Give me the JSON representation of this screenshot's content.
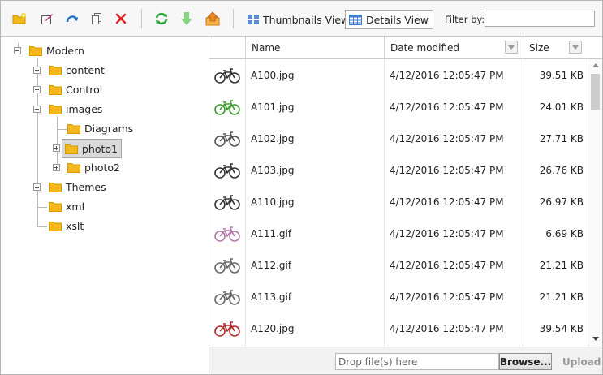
{
  "toolbar": {
    "buttons": [
      {
        "icon": "new-folder-icon",
        "color": "#e8a400"
      },
      {
        "icon": "rename-icon",
        "color": "#c12a7c"
      },
      {
        "icon": "redo-icon",
        "color": "#1f6fc4"
      },
      {
        "icon": "copy-icon",
        "color": "#555555"
      },
      {
        "icon": "delete-icon",
        "color": "#e02020"
      },
      {
        "icon": "refresh-icon",
        "color": "#2aa43a"
      },
      {
        "icon": "download-icon",
        "color": "#7fd07a"
      },
      {
        "icon": "upload-folder-icon",
        "color": "#e98a2a"
      }
    ],
    "thumbnails_view_label": "Thumbnails View",
    "details_view_label": "Details View",
    "filter_label": "Filter by:",
    "filter_value": ""
  },
  "tree": {
    "root": "Modern",
    "nodes": [
      "content",
      "Control",
      "images",
      "Diagrams",
      "photo1",
      "photo2",
      "Themes",
      "xml",
      "xslt"
    ],
    "selected": "photo1"
  },
  "grid": {
    "columns": [
      "Name",
      "Date modified",
      "Size"
    ],
    "rows": [
      {
        "name": "A100.jpg",
        "date": "4/12/2016 12:05:47 PM",
        "size": "39.51 KB",
        "bike_color": "#333333"
      },
      {
        "name": "A101.jpg",
        "date": "4/12/2016 12:05:47 PM",
        "size": "24.01 KB",
        "bike_color": "#3a9a2a"
      },
      {
        "name": "A102.jpg",
        "date": "4/12/2016 12:05:47 PM",
        "size": "27.71 KB",
        "bike_color": "#555555"
      },
      {
        "name": "A103.jpg",
        "date": "4/12/2016 12:05:47 PM",
        "size": "26.76 KB",
        "bike_color": "#333333"
      },
      {
        "name": "A110.jpg",
        "date": "4/12/2016 12:05:47 PM",
        "size": "26.97 KB",
        "bike_color": "#333333"
      },
      {
        "name": "A111.gif",
        "date": "4/12/2016 12:05:47 PM",
        "size": "6.69 KB",
        "bike_color": "#b07aa8"
      },
      {
        "name": "A112.gif",
        "date": "4/12/2016 12:05:47 PM",
        "size": "21.21 KB",
        "bike_color": "#666666"
      },
      {
        "name": "A113.gif",
        "date": "4/12/2016 12:05:47 PM",
        "size": "21.21 KB",
        "bike_color": "#666666"
      },
      {
        "name": "A120.jpg",
        "date": "4/12/2016 12:05:47 PM",
        "size": "39.54 KB",
        "bike_color": "#b02a2a"
      }
    ]
  },
  "upload": {
    "drop_placeholder": "Drop file(s) here",
    "browse_label": "Browse...",
    "upload_label": "Upload"
  },
  "colors": {
    "folder": "#f2b81d",
    "folder_dark": "#d99a00",
    "selection_bg": "#d9d9d9"
  }
}
